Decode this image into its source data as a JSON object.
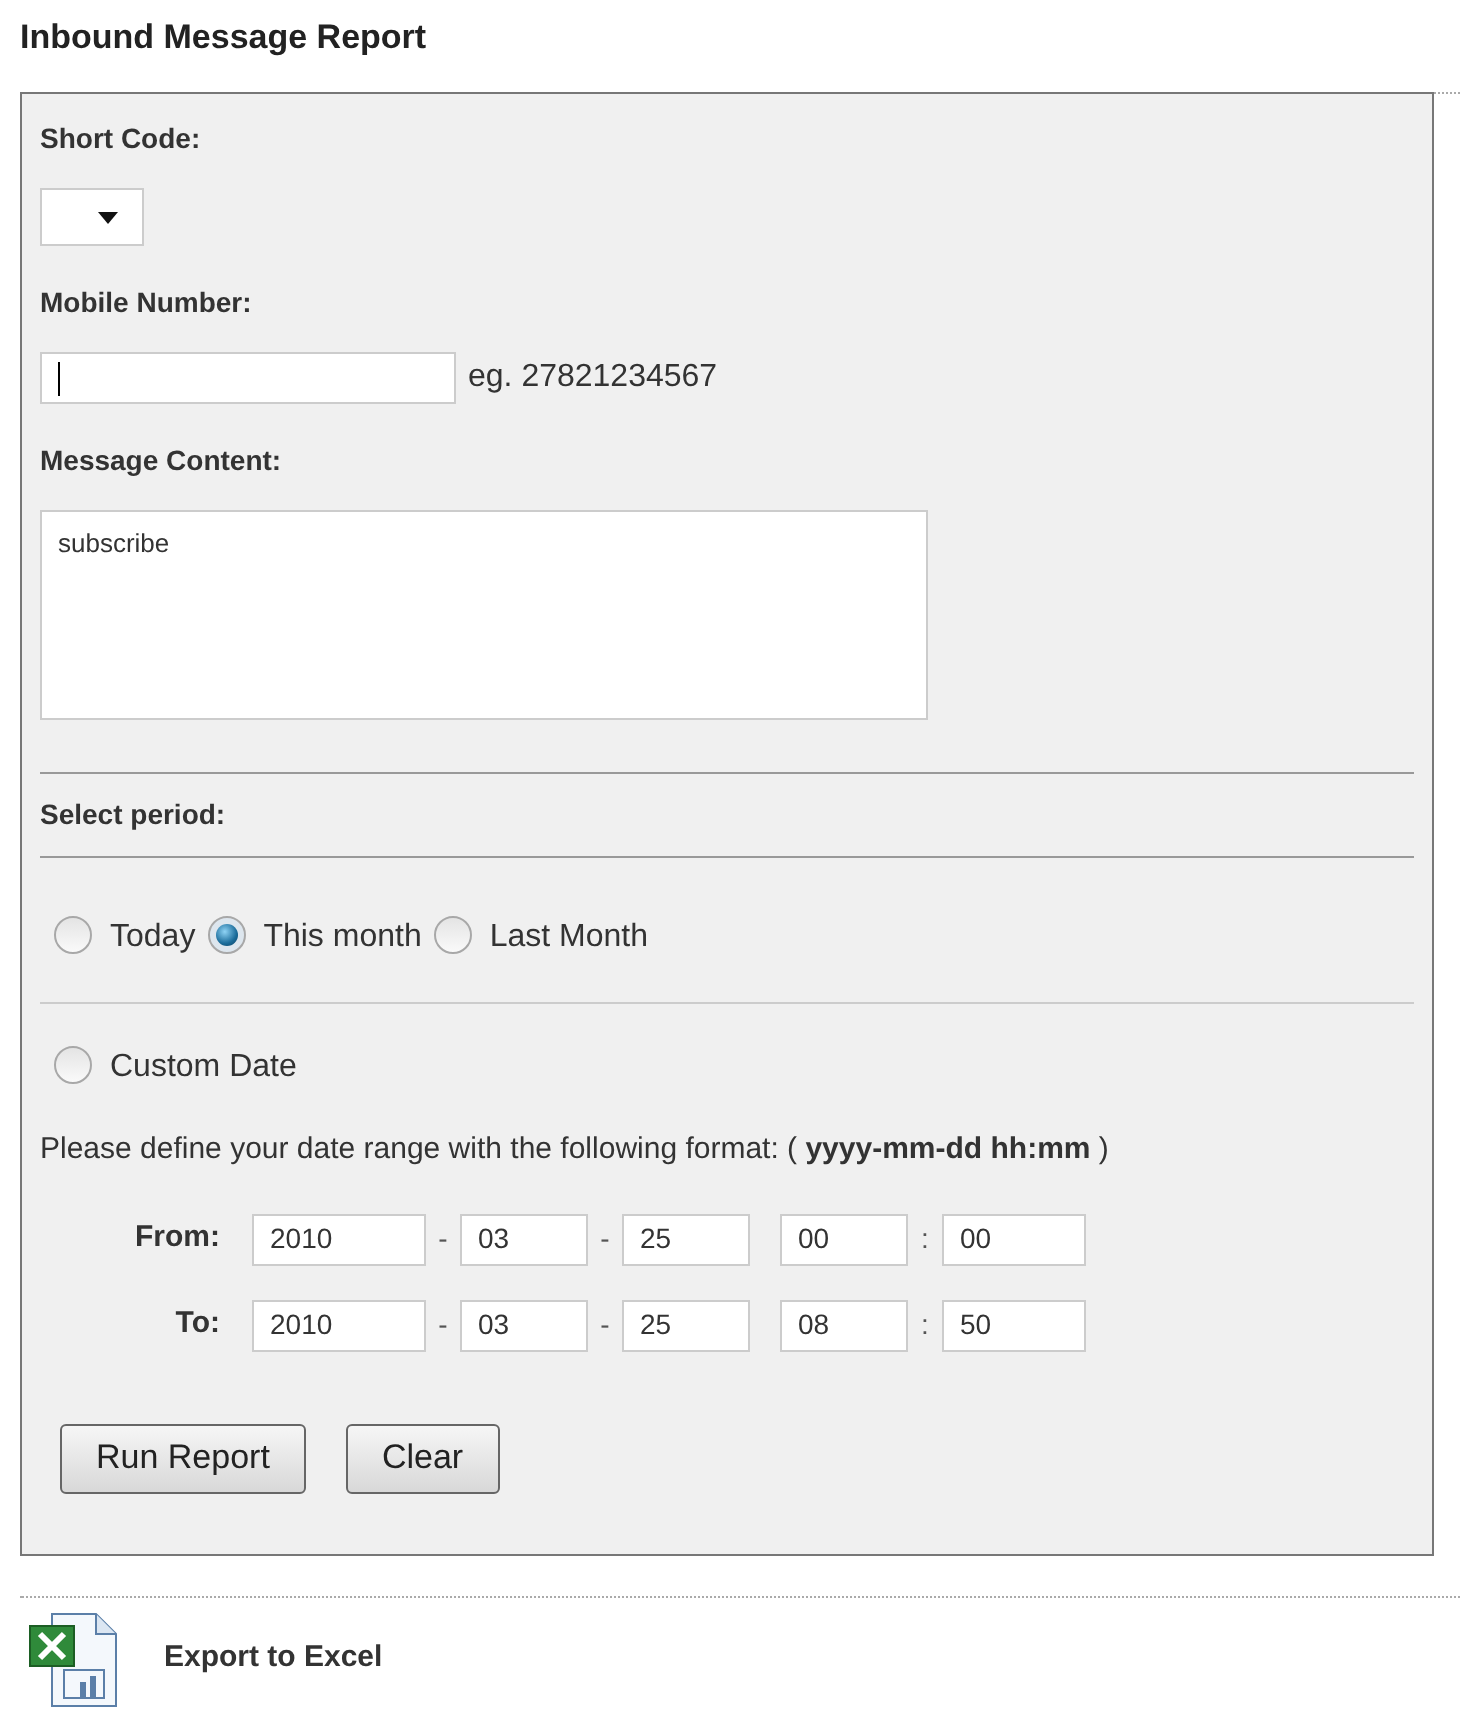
{
  "title": "Inbound Message Report",
  "short_code": {
    "label": "Short Code:"
  },
  "mobile_number": {
    "label": "Mobile Number:",
    "focused": true,
    "hint": "eg. 27821234567"
  },
  "message_content": {
    "label": "Message Content:",
    "value": "subscribe"
  },
  "period": {
    "label": "Select period:",
    "options": [
      {
        "label": "Today",
        "selected": false
      },
      {
        "label": "This month",
        "selected": true
      },
      {
        "label": "Last Month",
        "selected": false
      }
    ],
    "custom_date": {
      "label": "Custom Date",
      "selected": false
    },
    "format_hint": "Please define your date range with the following format: ( **yyyy-mm-dd hh:mm** )",
    "ranges": [
      {
        "label": "From:",
        "items": [
          {
            "kind": "field",
            "value": "2010"
          },
          {
            "kind": "sep",
            "text": "-"
          },
          {
            "kind": "field",
            "value": "03"
          },
          {
            "kind": "sep",
            "text": "-"
          },
          {
            "kind": "field",
            "value": "25"
          },
          {
            "kind": "gap"
          },
          {
            "kind": "field",
            "value": "00"
          },
          {
            "kind": "sep",
            "text": ":"
          },
          {
            "kind": "field",
            "value": "00"
          }
        ]
      },
      {
        "label": "To:",
        "items": [
          {
            "kind": "field",
            "value": "2010"
          },
          {
            "kind": "sep",
            "text": "-"
          },
          {
            "kind": "field",
            "value": "03"
          },
          {
            "kind": "sep",
            "text": "-"
          },
          {
            "kind": "field",
            "value": "25"
          },
          {
            "kind": "gap"
          },
          {
            "kind": "field",
            "value": "08"
          },
          {
            "kind": "sep",
            "text": ":"
          },
          {
            "kind": "field",
            "value": "50"
          }
        ]
      }
    ]
  },
  "buttons": [
    "Run Report",
    "Clear"
  ],
  "export": {
    "label": "Export to Excel"
  }
}
